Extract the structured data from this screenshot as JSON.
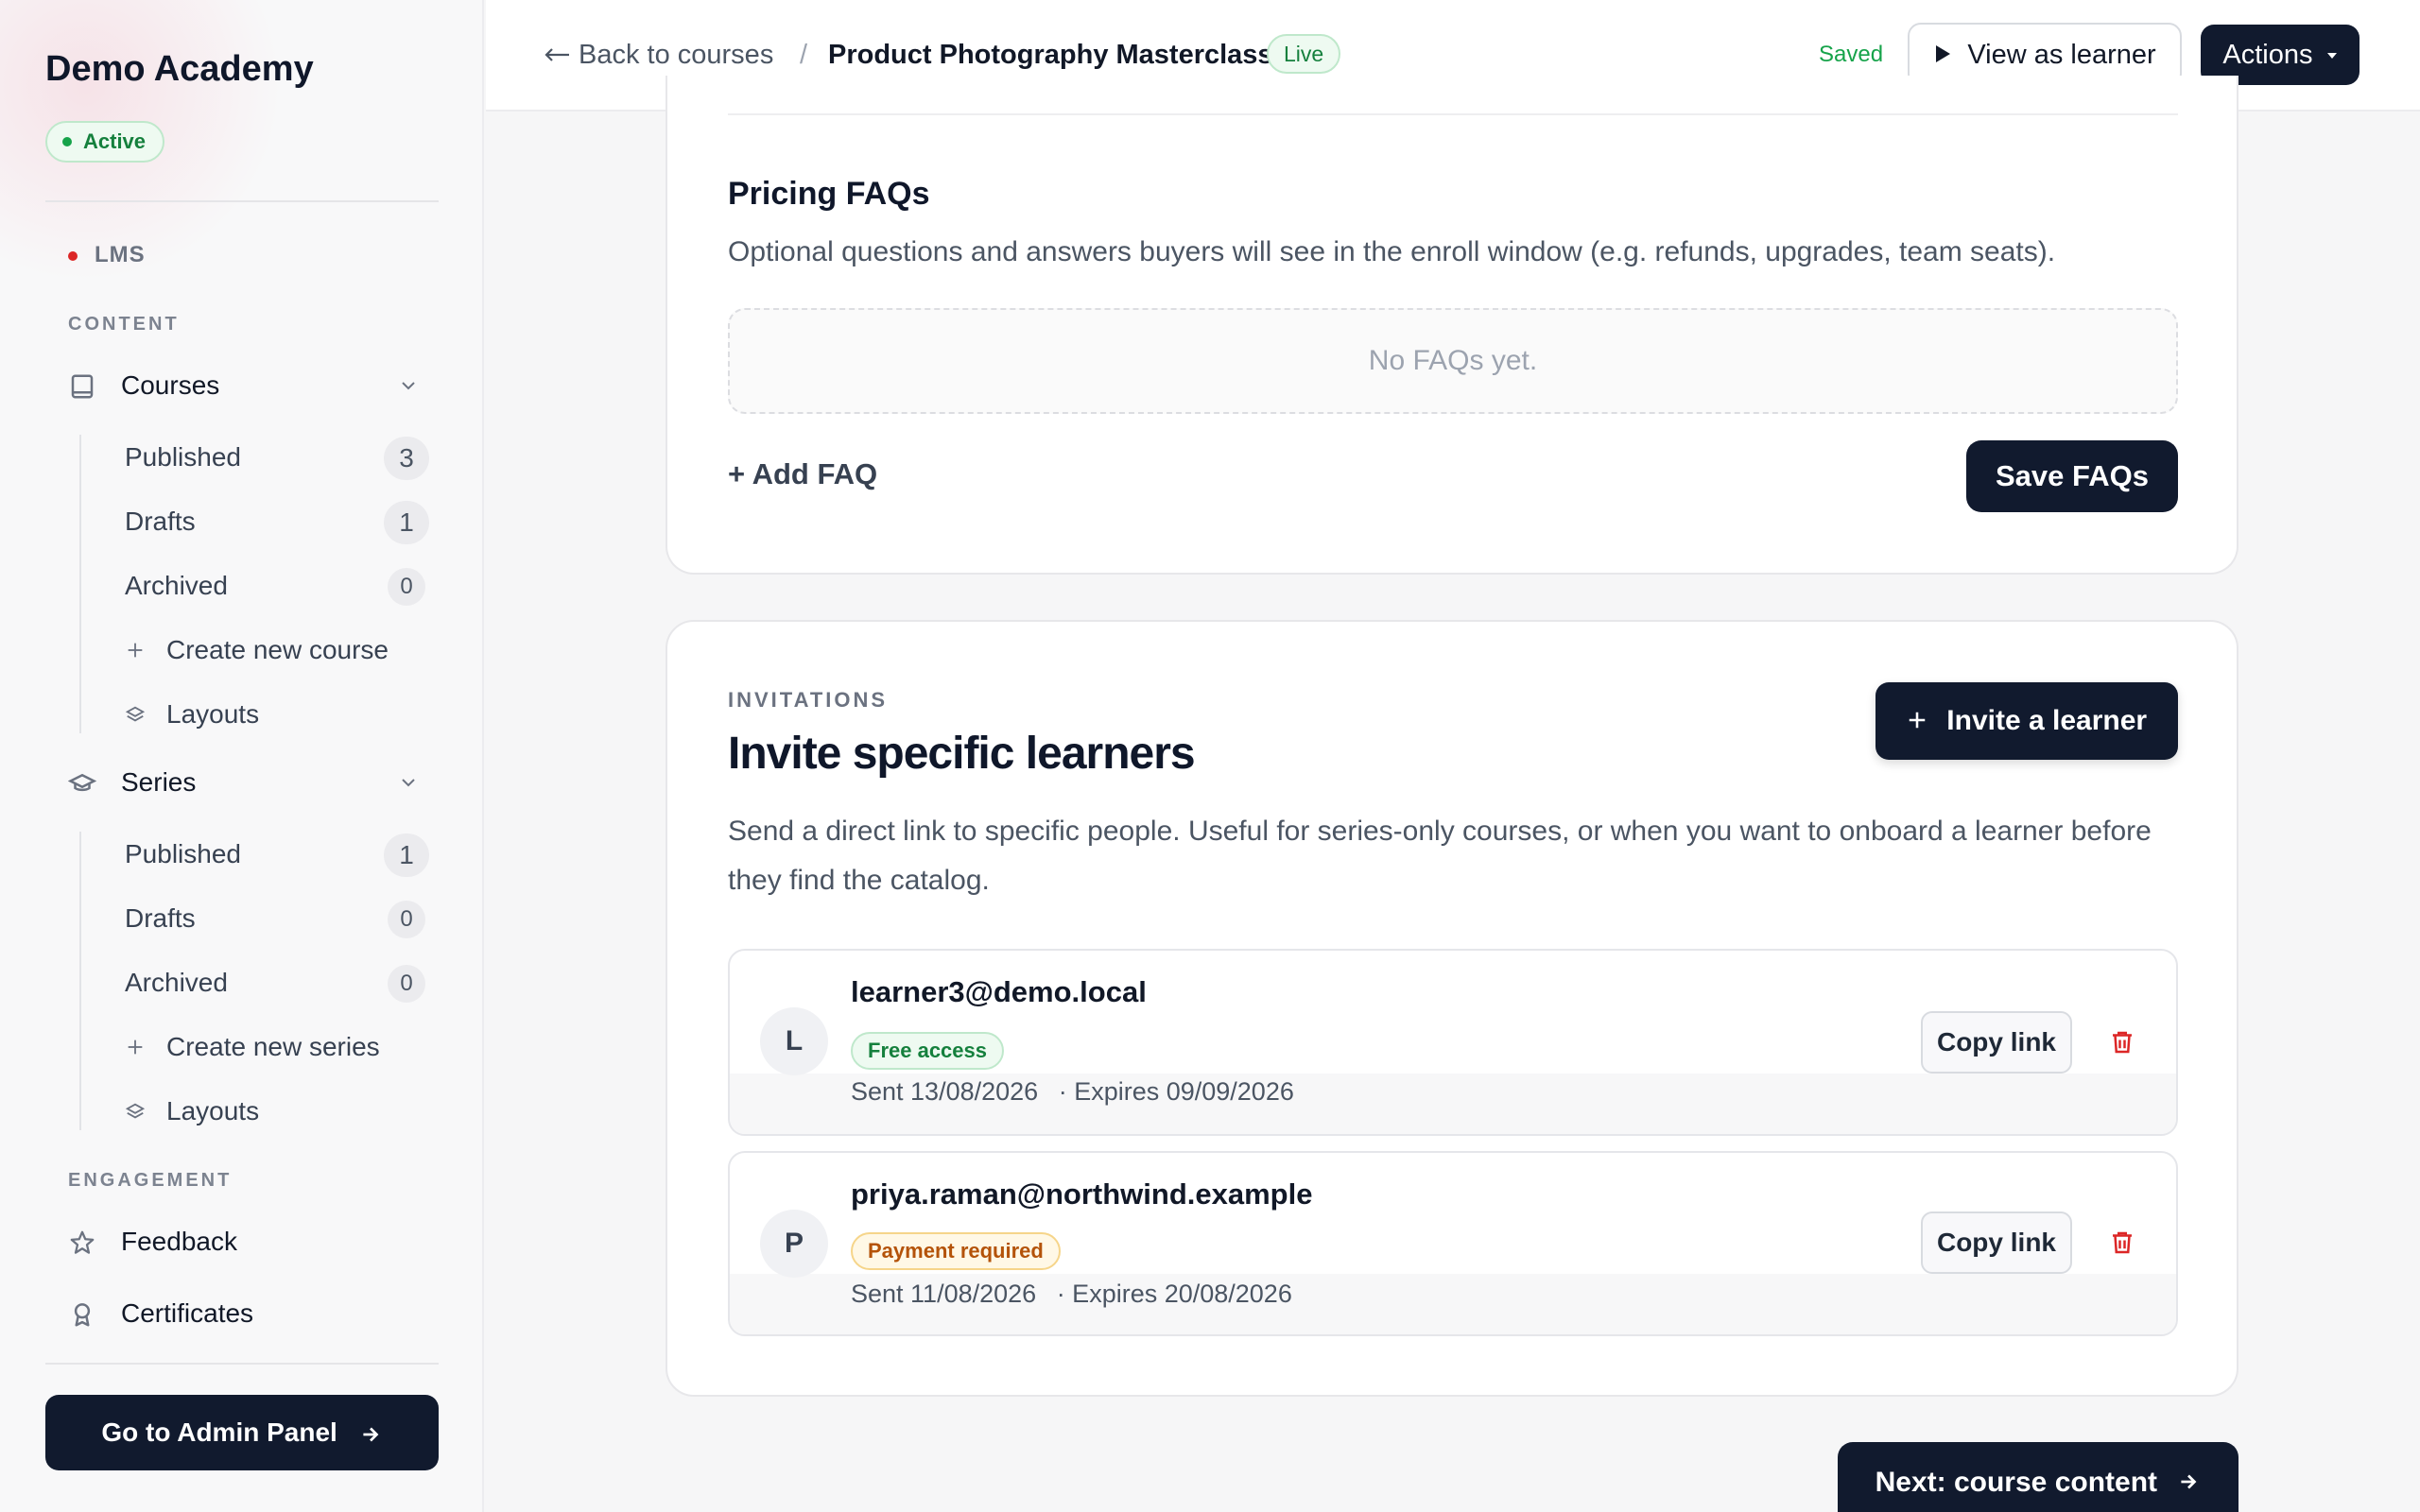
{
  "sidebar": {
    "brand": "Demo Academy",
    "status": "Active",
    "app_label": "LMS",
    "section_content": "CONTENT",
    "courses": {
      "label": "Courses",
      "items": [
        {
          "label": "Published",
          "count": "3"
        },
        {
          "label": "Drafts",
          "count": "1"
        },
        {
          "label": "Archived",
          "count": "0"
        }
      ],
      "create": "Create new course",
      "layouts": "Layouts"
    },
    "series": {
      "label": "Series",
      "items": [
        {
          "label": "Published",
          "count": "1"
        },
        {
          "label": "Drafts",
          "count": "0"
        },
        {
          "label": "Archived",
          "count": "0"
        }
      ],
      "create": "Create new series",
      "layouts": "Layouts"
    },
    "section_engagement": "ENGAGEMENT",
    "feedback": "Feedback",
    "certificates": "Certificates",
    "admin_button": "Go to Admin Panel"
  },
  "topbar": {
    "back": "Back to courses",
    "separator": "/",
    "course_title": "Product Photography Masterclass",
    "status_badge": "Live",
    "saved": "Saved",
    "view_as_learner": "View as learner",
    "actions": "Actions"
  },
  "faq": {
    "title": "Pricing FAQs",
    "description": "Optional questions and answers buyers will see in the enroll window (e.g. refunds, upgrades, team seats).",
    "empty": "No FAQs yet.",
    "add": "+ Add FAQ",
    "save": "Save FAQs"
  },
  "invitations": {
    "label": "INVITATIONS",
    "title": "Invite specific learners",
    "invite_button": "Invite a learner",
    "description": "Send a direct link to specific people. Useful for series-only courses, or when you want to onboard a learner before they find the catalog.",
    "rows": [
      {
        "initial": "L",
        "email": "learner3@demo.local",
        "access": "Free access",
        "sent": "Sent 13/08/2026",
        "expires": "· Expires 09/09/2026",
        "copy": "Copy link"
      },
      {
        "initial": "P",
        "email": "priya.raman@northwind.example",
        "access": "Payment required",
        "sent": "Sent 11/08/2026",
        "expires": "· Expires 20/08/2026",
        "copy": "Copy link"
      }
    ]
  },
  "footer": {
    "next": "Next: course content"
  },
  "colors": {
    "primary": "#111a2e",
    "success": "#15803d",
    "warning": "#b45309",
    "danger": "#dc2626"
  },
  "icons": {
    "courses": "book-icon",
    "series": "graduation-cap-icon",
    "feedback": "star-icon",
    "certificates": "award-icon",
    "layouts": "layers-icon",
    "delete": "trash-icon"
  }
}
